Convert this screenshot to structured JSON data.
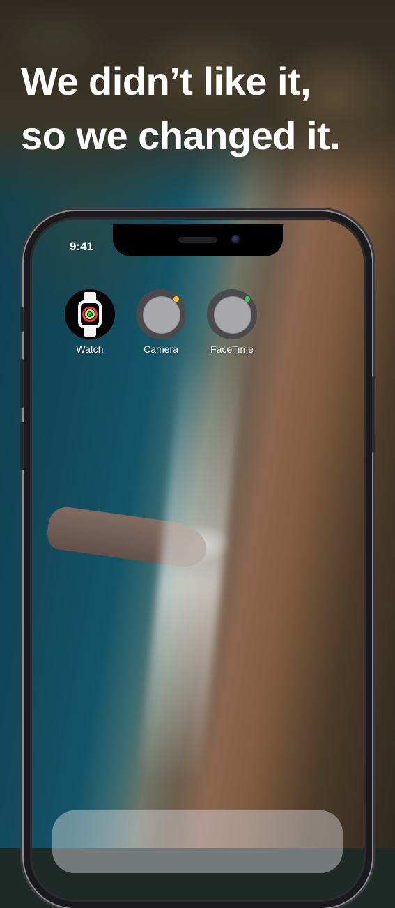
{
  "headline": {
    "line1": "We didn’t like it,",
    "line2": "so we changed it."
  },
  "phone": {
    "status_time": "9:41",
    "apps": [
      {
        "label": "Watch",
        "icon": "watch-icon"
      },
      {
        "label": "Camera",
        "icon": "camera-icon",
        "indicator_color": "#f5c518"
      },
      {
        "label": "FaceTime",
        "icon": "facetime-icon",
        "indicator_color": "#34c759"
      }
    ]
  },
  "colors": {
    "headline_text": "#ffffff",
    "activity_move": "#ff2d55",
    "activity_exercise": "#a8ff2f",
    "activity_stand": "#1fd3e0"
  }
}
